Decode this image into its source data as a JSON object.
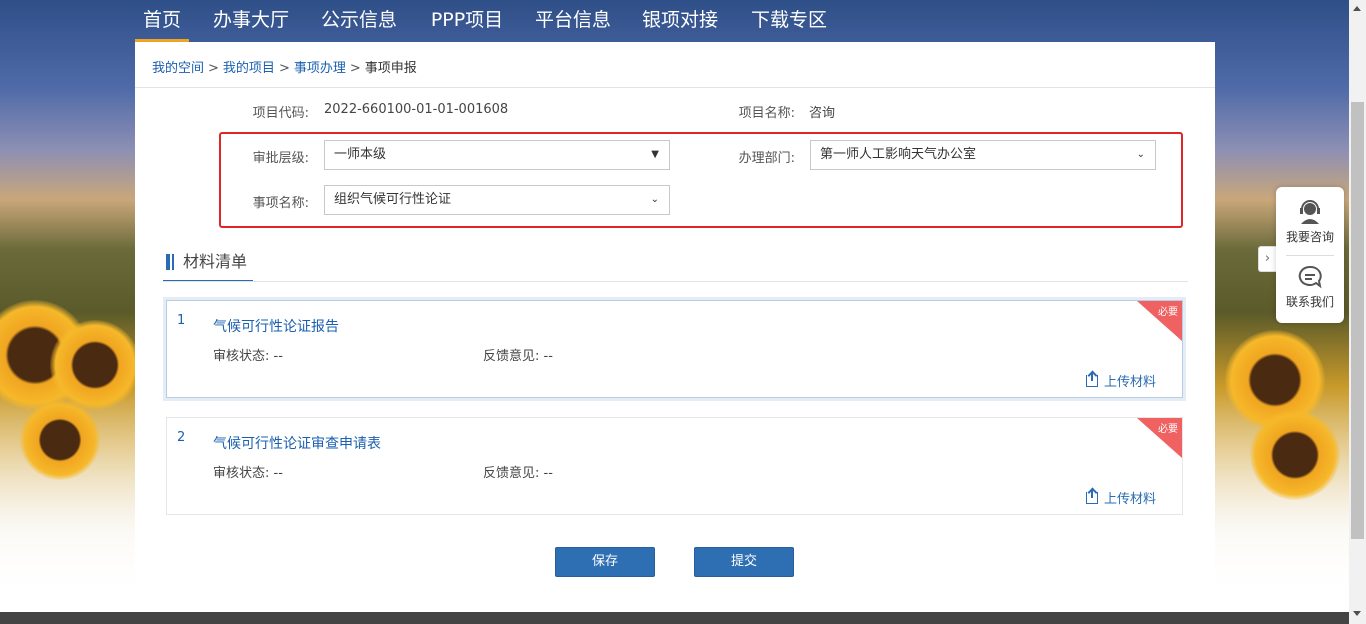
{
  "nav": {
    "items": [
      "首页",
      "办事大厅",
      "公示信息",
      "PPP项目",
      "平台信息",
      "银项对接",
      "下载专区"
    ],
    "active": "首页"
  },
  "breadcrumb": {
    "items": [
      "我的空间",
      "我的项目",
      "事项办理"
    ],
    "current": "事项申报",
    "separator": ">"
  },
  "project": {
    "code_label": "项目代码:",
    "code_value": "2022-660100-01-01-001608",
    "name_label": "项目名称:",
    "name_value": "咨询"
  },
  "form": {
    "level_label": "审批层级:",
    "level_value": "一师本级",
    "dept_label": "办理部门:",
    "dept_value": "第一师人工影响天气办公室",
    "item_label": "事项名称:",
    "item_value": "组织气候可行性论证"
  },
  "materials": {
    "section_title": "材料清单",
    "status_label": "审核状态:",
    "feedback_label": "反馈意见:",
    "upload_label": "上传材料",
    "required_tag": "必要",
    "items": [
      {
        "num": "1",
        "title": "气候可行性论证报告",
        "status": "--",
        "feedback": "--"
      },
      {
        "num": "2",
        "title": "气候可行性论证审查申请表",
        "status": "--",
        "feedback": "--"
      }
    ]
  },
  "buttons": {
    "save": "保存",
    "submit": "提交"
  },
  "float": {
    "consult": "我要咨询",
    "contact": "联系我们",
    "toggle": "›"
  },
  "colors": {
    "accent": "#2e6fb3",
    "link": "#1a5fb0",
    "highlight": "#e02727",
    "tag": "#f06262",
    "nav_underline": "#f1a322"
  }
}
